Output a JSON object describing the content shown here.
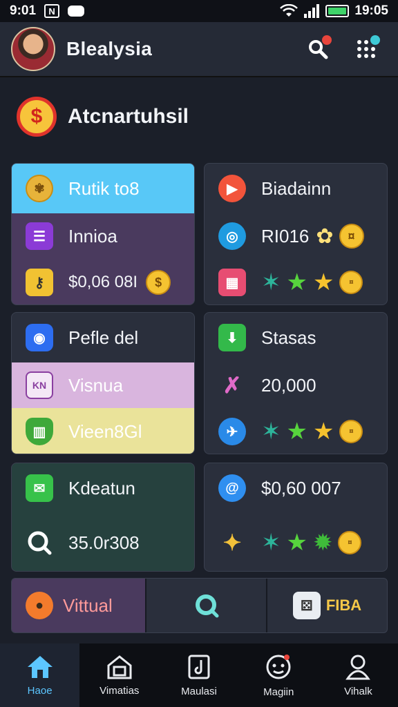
{
  "status": {
    "time_left": "9:01",
    "time_right": "19:05"
  },
  "header": {
    "app_name": "Blealysia"
  },
  "section": {
    "title": "Atcnartuhsil"
  },
  "cards": {
    "c1": {
      "top_label": "Rutik to8",
      "row2_label": "Innioa",
      "row3_value": "$0,06 08I"
    },
    "c2": {
      "top_label": "Biadainn",
      "row2_value": "RI016"
    },
    "c3": {
      "top_label": "Pefle del",
      "row2_label": "Visnua",
      "row3_label": "Vieen8Gl"
    },
    "c4": {
      "top_label": "Stasas",
      "row2_value": "20,000"
    },
    "c5": {
      "top_label": "Kdeatun",
      "row2_value": "35.0r308"
    },
    "c6": {
      "top_label": "$0,60 007"
    }
  },
  "bottom_bar": {
    "virtual_label": "Vittual",
    "right_label": "FIBA"
  },
  "nav": {
    "items": [
      {
        "label": "Haoe"
      },
      {
        "label": "Vimatias"
      },
      {
        "label": "Maulasi"
      },
      {
        "label": "Magiin"
      },
      {
        "label": "Vihalk"
      }
    ]
  },
  "colors": {
    "accent_blue": "#58c8f7",
    "card_purple": "#4a3a5e",
    "card_pink": "#d9b5de",
    "card_yellow": "#eae39a",
    "card_green": "#26413e",
    "star_green": "#57d43d",
    "star_gold": "#f5c22e"
  },
  "icons": {
    "search": "search-icon",
    "grid": "grid-icon",
    "home": "home-icon",
    "store": "store-icon",
    "music": "music-icon",
    "game": "game-icon",
    "profile": "profile-icon"
  }
}
